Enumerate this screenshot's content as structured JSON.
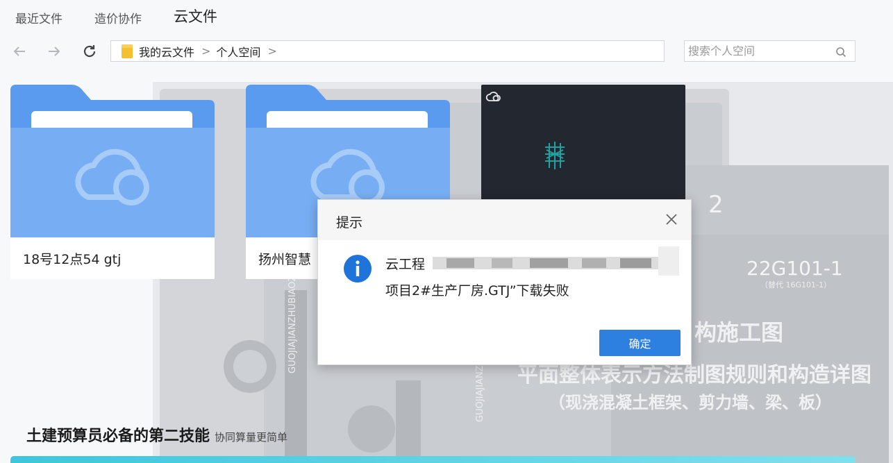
{
  "tabs": [
    {
      "label": "最近文件"
    },
    {
      "label": "造价协作"
    },
    {
      "label": "云文件"
    }
  ],
  "breadcrumb": {
    "root": "我的云文件",
    "level1": "个人空间",
    "sep": ">"
  },
  "search": {
    "placeholder": "搜索个人空间"
  },
  "files": [
    {
      "name": "18号12点54 gtj",
      "icon": "folder-cloud-icon"
    },
    {
      "name": "扬州智慧",
      "icon": "folder-cloud-icon"
    }
  ],
  "promo": {
    "title": "土建预算员必备的第二技能",
    "subtitle": "协同算量更简单"
  },
  "poster_text": {
    "code": "22G101-1",
    "code_sub": "（替代 16G101-1）",
    "line1": "构施工图",
    "line2": "平面整体表示方法制图规则和构造详图",
    "line3": "（现浇混凝土框架、剪力墙、梁、板）",
    "vertical": "GUOJIAJIANZHUBIAOZHUN",
    "digit": "2"
  },
  "dialog": {
    "title": "提示",
    "message_line1": "云工程",
    "message_line2": "项目2#生产厂房.GTJ”下载失败",
    "ok_label": "确定"
  },
  "colors": {
    "folder_blue": "#5a9bf0",
    "button_blue": "#2d7fe0",
    "info_blue": "#1e74d8",
    "dark_card": "#222730",
    "bar_cyan": "#3fc6dc"
  }
}
